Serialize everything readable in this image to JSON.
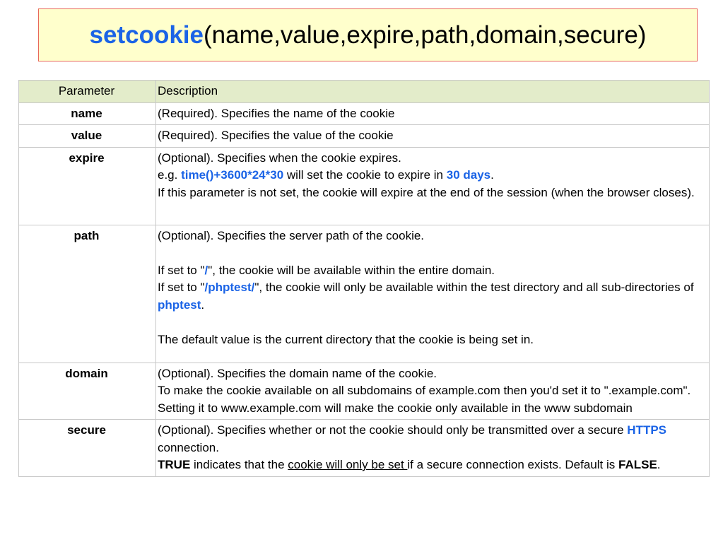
{
  "title": {
    "function": "setcookie",
    "args": "(name,value,expire,path,domain,secure)"
  },
  "table": {
    "headers": {
      "parameter": "Parameter",
      "description": "Description"
    },
    "rows": {
      "name": {
        "param": "name",
        "desc": "(Required). Specifies the name of the cookie"
      },
      "value": {
        "param": "value",
        "desc": "(Required). Specifies the value of the cookie"
      },
      "expire": {
        "param": "expire",
        "line1": "(Optional). Specifies when the cookie expires.",
        "line2_prefix": "e.g. ",
        "line2_code": "time()+3600*24*30",
        "line2_mid": " will set the cookie to expire in ",
        "line2_hl": "30 days",
        "line2_end": ".",
        "line3": "If this parameter is not set, the cookie will expire at the end of the session (when the browser closes)."
      },
      "path": {
        "param": "path",
        "line1": "(Optional). Specifies the server path of the cookie.",
        "line2_a": "If set to \"",
        "line2_hl": "/",
        "line2_b": "\", the cookie will be available within the entire domain.",
        "line3_a": "If set to \"",
        "line3_hl": "/phptest/",
        "line3_b": "\", the cookie will only be available within the test directory and all sub-directories of ",
        "line3_hl2": "phptest",
        "line3_end": ".",
        "line4": "The default value is the current directory that the cookie is being set in."
      },
      "domain": {
        "param": "domain",
        "line1": "(Optional). Specifies the domain name of the cookie.",
        "line2": "To make the cookie available on all subdomains of example.com then you'd set it to \".example.com\".",
        "line3": "Setting it to www.example.com will make the cookie only available in the www subdomain"
      },
      "secure": {
        "param": "secure",
        "line1_a": "(Optional). Specifies whether or not the cookie should only be transmitted over a secure ",
        "line1_hl": "HTTPS",
        "line1_b": " connection.",
        "line2_bold": "TRUE",
        "line2_a": " indicates that the ",
        "line2_u": "cookie will only be set ",
        "line2_b": "if a secure connection exists. Default is ",
        "line2_bold2": "FALSE",
        "line2_end": "."
      }
    }
  },
  "colors": {
    "accent_blue": "#1a63e6",
    "title_bg": "#ffffcc",
    "title_border": "#e8685a",
    "header_bg": "#e3ecca"
  }
}
